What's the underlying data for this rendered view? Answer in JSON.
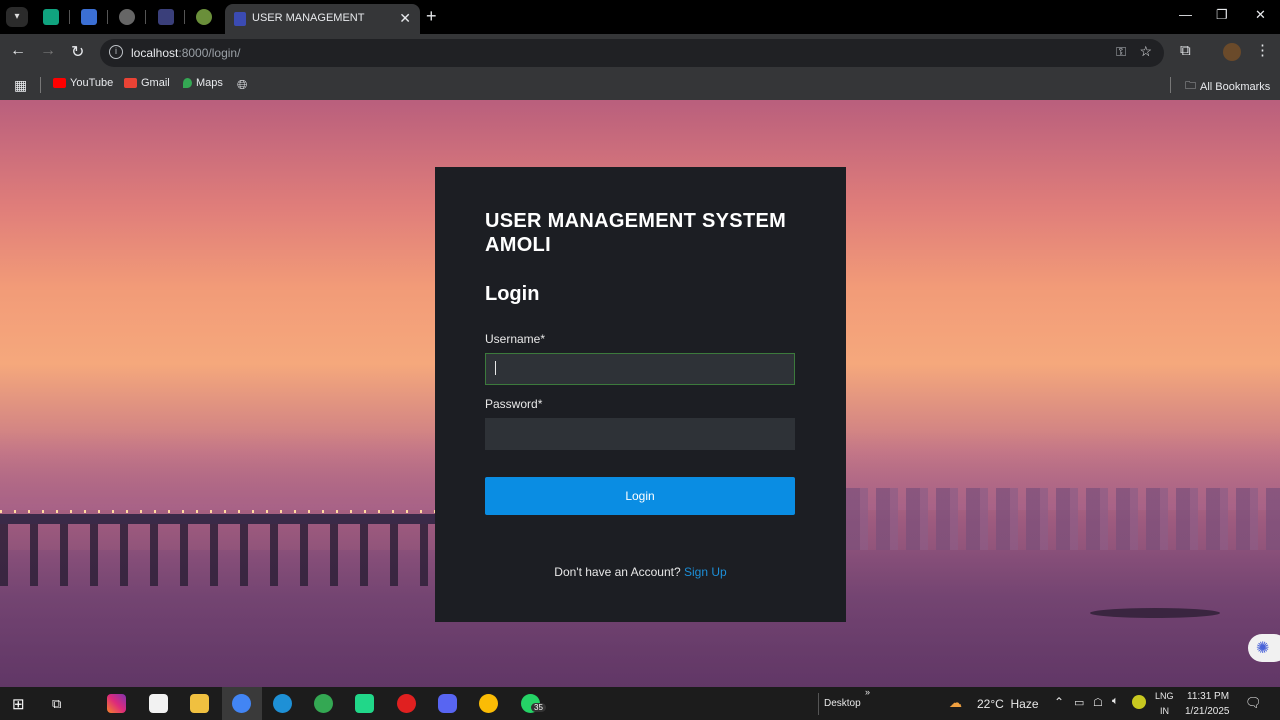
{
  "browser": {
    "active_tab_title": "USER MANAGEMENT",
    "url_host": "localhost",
    "url_path": ":8000/login/",
    "bookmarks": [
      {
        "label": "YouTube",
        "color": "#ff0000"
      },
      {
        "label": "Gmail",
        "color": "#ea4335"
      },
      {
        "label": "Maps",
        "color": "#34a853"
      }
    ],
    "all_bookmarks_label": "All Bookmarks"
  },
  "login": {
    "system_title": "USER MANAGEMENT SYSTEM AMOLI",
    "heading": "Login",
    "username_label": "Username*",
    "username_value": "",
    "password_label": "Password*",
    "password_value": "",
    "button_label": "Login",
    "signup_prompt": "Don't have an Account?",
    "signup_link": "Sign Up"
  },
  "taskbar": {
    "desktop_label": "Desktop",
    "weather": "22°C  Haze",
    "lang_1": "LNG",
    "lang_2": "IN",
    "time": "11:31 PM",
    "date": "1/21/2025",
    "whatsapp_badge": "35"
  },
  "colors": {
    "card_bg": "#1c1e23",
    "button_bg": "#0a8de3",
    "link": "#1d8fd8",
    "field_bg": "#2e3237"
  }
}
